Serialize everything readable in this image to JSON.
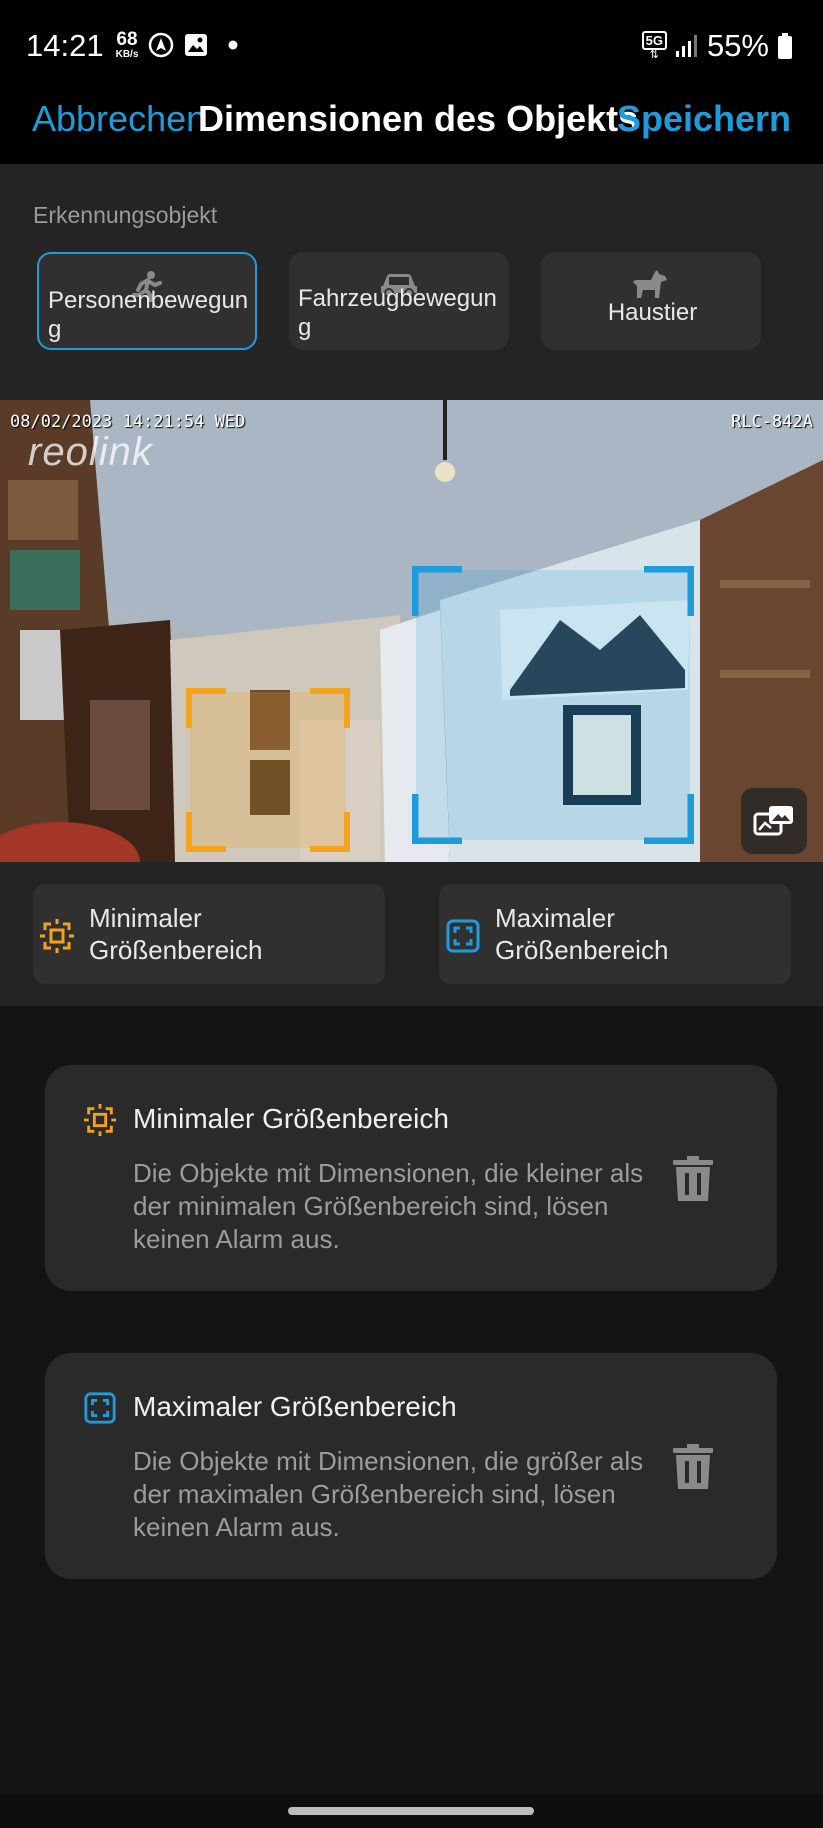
{
  "status_bar": {
    "time": "14:21",
    "net_speed": "68",
    "net_unit": "KB/s",
    "network": "5G",
    "battery": "55%"
  },
  "header": {
    "cancel": "Abbrechen",
    "title": "Dimensionen des Objekts",
    "save": "Speichern"
  },
  "detection": {
    "label": "Erkennungsobjekt",
    "options": [
      {
        "label": "Personenbewegung",
        "icon": "person-running-icon",
        "selected": true
      },
      {
        "label": "Fahrzeugbewegung",
        "icon": "car-icon",
        "selected": false
      },
      {
        "label": "Haustier",
        "icon": "dog-icon",
        "selected": false
      }
    ]
  },
  "camera": {
    "timestamp": "08/02/2023 14:21:54 WED",
    "model": "RLC-842A",
    "logo": "reolink"
  },
  "ranges": {
    "min": {
      "label": "Minimaler Größenbereich",
      "color": "#f5a31a"
    },
    "max": {
      "label": "Maximaler Größenbereich",
      "color": "#1e9bdb"
    }
  },
  "cards": [
    {
      "title": "Minimaler Größenbereich",
      "description": "Die Objekte mit Dimensionen, die kleiner als der minimalen Größenbereich sind, lösen keinen Alarm aus."
    },
    {
      "title": "Maximaler Größenbereich",
      "description": "Die Objekte mit Dimensionen, die größer als der maximalen Größenbereich sind, lösen keinen Alarm aus."
    }
  ],
  "colors": {
    "accent": "#1e9bdb",
    "min_range": "#f5a31a"
  }
}
